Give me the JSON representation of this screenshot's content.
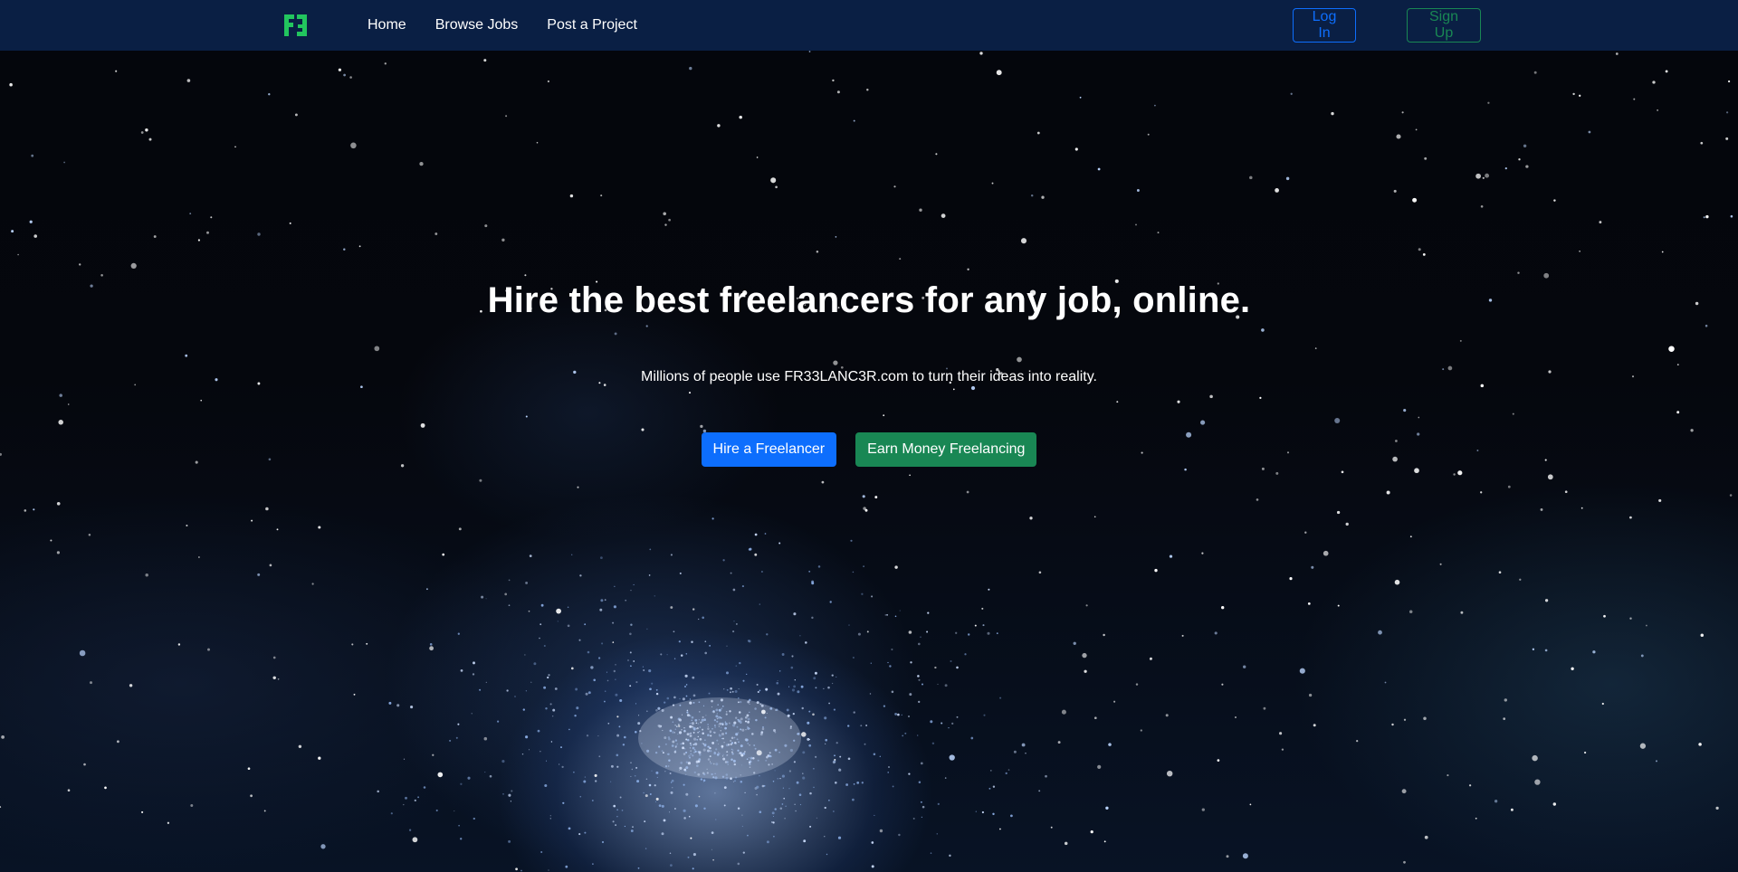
{
  "nav": {
    "logo_icon": "f3-logo-icon",
    "logo_color": "#22c55e",
    "links": [
      {
        "label": "Home"
      },
      {
        "label": "Browse Jobs"
      },
      {
        "label": "Post a Project"
      }
    ],
    "login_label": "Log In",
    "signup_label": "Sign Up"
  },
  "hero": {
    "title": "Hire the best freelancers for any job, online.",
    "subtitle": "Millions of people use FR33LANC3R.com to turn their ideas into reality.",
    "hire_button": "Hire a Freelancer",
    "earn_button": "Earn Money Freelancing",
    "background": "starfield-image"
  },
  "colors": {
    "navbar": "#0a1f44",
    "primary": "#0d6efd",
    "success": "#198754"
  }
}
